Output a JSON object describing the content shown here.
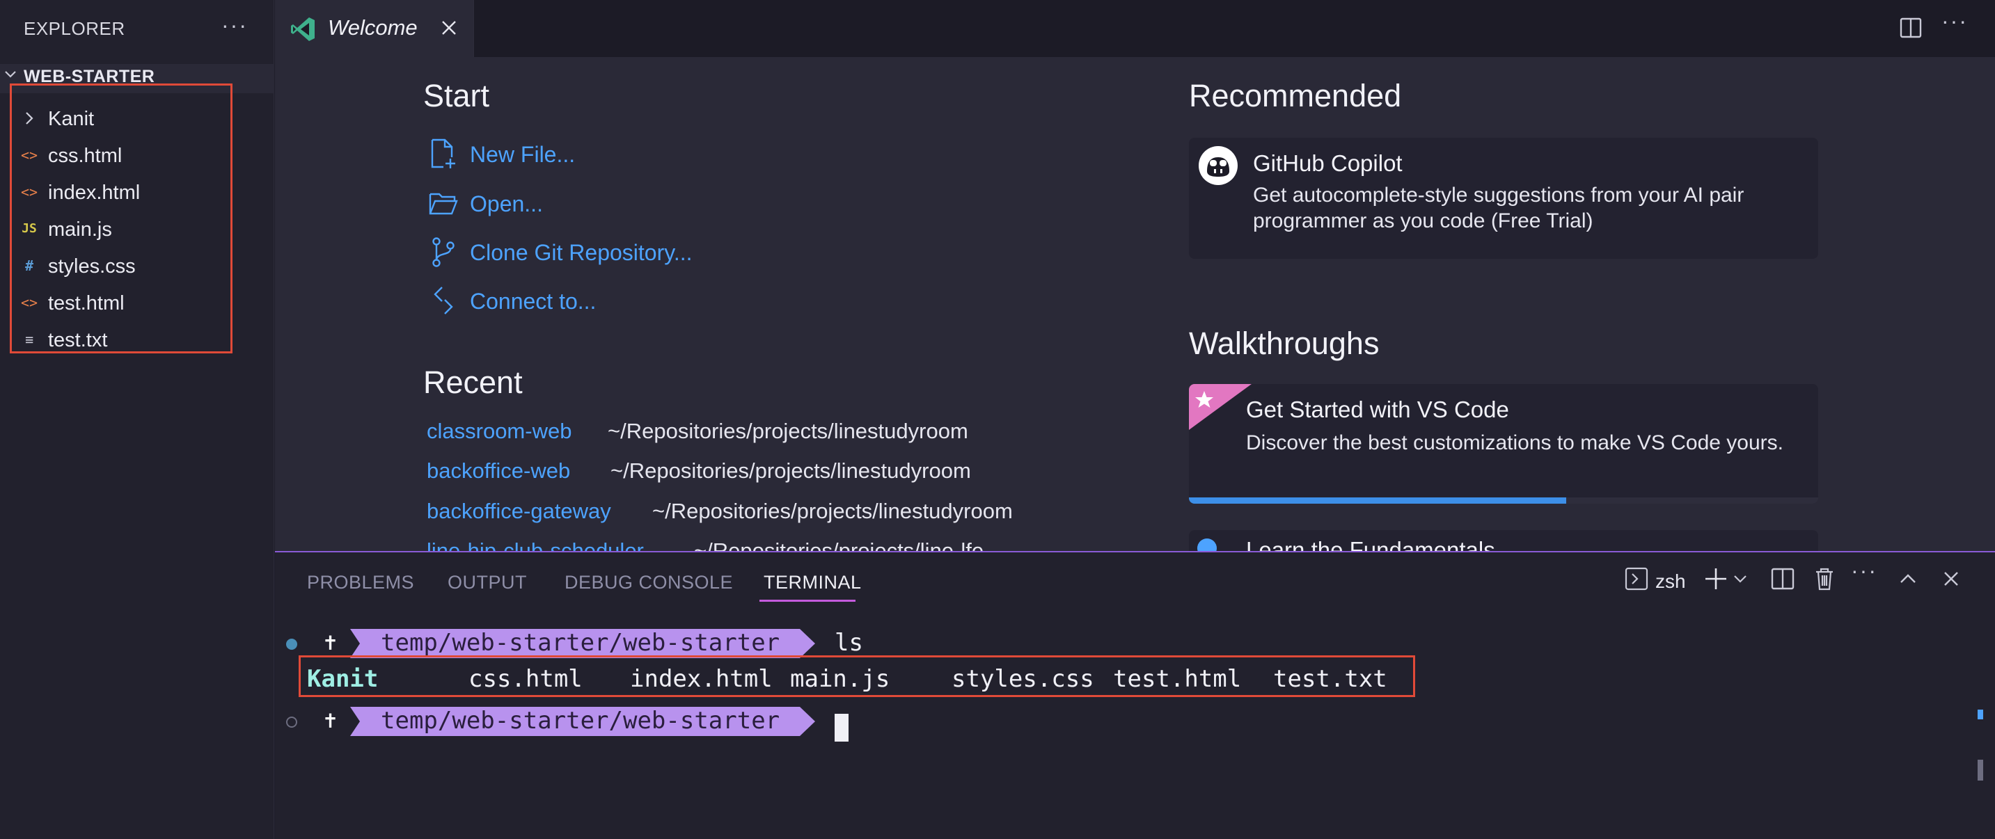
{
  "sidebar": {
    "title": "EXPLORER",
    "more_icon": "ellipsis-icon",
    "project": "WEB-STARTER",
    "items": [
      {
        "label": "Kanit",
        "icon": "chevron-right-icon",
        "kind": "folder"
      },
      {
        "label": "css.html",
        "icon": "html-file-icon",
        "glyph": "<>"
      },
      {
        "label": "index.html",
        "icon": "html-file-icon",
        "glyph": "<>"
      },
      {
        "label": "main.js",
        "icon": "js-file-icon",
        "glyph": "JS"
      },
      {
        "label": "styles.css",
        "icon": "css-file-icon",
        "glyph": "#"
      },
      {
        "label": "test.html",
        "icon": "html-file-icon",
        "glyph": "<>"
      },
      {
        "label": "test.txt",
        "icon": "text-file-icon",
        "glyph": "≡"
      }
    ]
  },
  "tabs": [
    {
      "label": "Welcome",
      "icon": "vscode-logo-icon",
      "active": true
    }
  ],
  "welcome": {
    "start": {
      "title": "Start",
      "items": [
        {
          "label": "New File...",
          "icon": "new-file-icon"
        },
        {
          "label": "Open...",
          "icon": "folder-open-icon"
        },
        {
          "label": "Clone Git Repository...",
          "icon": "git-branch-icon"
        },
        {
          "label": "Connect to...",
          "icon": "remote-icon"
        }
      ]
    },
    "recent": {
      "title": "Recent",
      "items": [
        {
          "name": "classroom-web",
          "path": "~/Repositories/projects/linestudyroom"
        },
        {
          "name": "backoffice-web",
          "path": "~/Repositories/projects/linestudyroom"
        },
        {
          "name": "backoffice-gateway",
          "path": "~/Repositories/projects/linestudyroom"
        },
        {
          "name": "line-hip-club-scheduler",
          "path": "~/Repositories/projects/line-lfe"
        }
      ]
    },
    "recommended": {
      "title": "Recommended",
      "card": {
        "title": "GitHub Copilot",
        "description": "Get autocomplete-style suggestions from your AI pair programmer as you code (Free Trial)",
        "icon": "copilot-icon"
      }
    },
    "walkthroughs": {
      "title": "Walkthroughs",
      "card": {
        "title": "Get Started with VS Code",
        "description": "Discover the best customizations to make VS Code yours.",
        "icon": "star-badge-icon",
        "progress": 0.6
      },
      "next_card_title": "Learn the Fundamentals"
    }
  },
  "panel": {
    "tabs": [
      "PROBLEMS",
      "OUTPUT",
      "DEBUG CONSOLE",
      "TERMINAL"
    ],
    "active_tab": "TERMINAL",
    "shell": "zsh",
    "actions": [
      "terminal-icon",
      "plus-icon",
      "chevron-down-icon",
      "split-terminal-icon",
      "trash-icon",
      "ellipsis-icon",
      "chevron-up-icon",
      "close-icon"
    ]
  },
  "terminal": {
    "prompt_symbol": "✝",
    "prompt_path": "temp/web-starter/web-starter",
    "command": "ls",
    "ls_output": [
      {
        "name": "Kanit",
        "type": "dir"
      },
      {
        "name": "css.html",
        "type": "file"
      },
      {
        "name": "index.html",
        "type": "file"
      },
      {
        "name": "main.js",
        "type": "file"
      },
      {
        "name": "styles.css",
        "type": "file"
      },
      {
        "name": "test.html",
        "type": "file"
      },
      {
        "name": "test.txt",
        "type": "file"
      }
    ]
  },
  "colors": {
    "accent_blue": "#4da3ff",
    "prompt_purple": "#b892ee",
    "highlight_red": "#e04a38",
    "dir_cyan": "#9feee4",
    "html_orange": "#e8804a",
    "js_yellow": "#d6c84a",
    "css_blue": "#5b9bd5"
  }
}
